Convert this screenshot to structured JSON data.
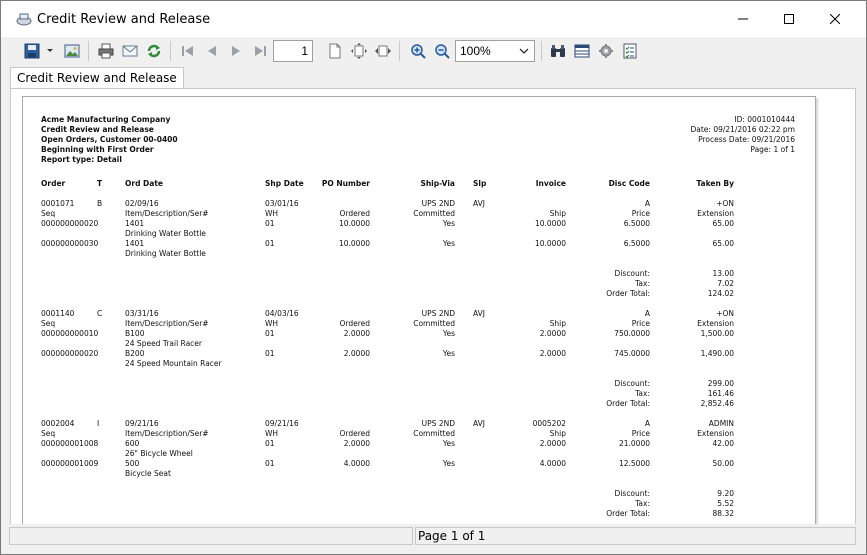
{
  "window": {
    "title": "Credit Review and Release"
  },
  "toolbar": {
    "page_number": "1",
    "zoom": "100%"
  },
  "tab": {
    "label": "Credit Review and Release"
  },
  "report": {
    "header_left": [
      "Acme Manufacturing Company",
      "Credit Review and Release",
      "Open Orders, Customer 00-0400",
      "Beginning with First Order",
      "Report type: Detail"
    ],
    "header_right": [
      "ID: 0001010444",
      "Date: 09/21/2016 02:22 pm",
      "Process Date: 09/21/2016",
      "Page: 1 of 1"
    ],
    "columns": {
      "order": "Order",
      "t": "T",
      "ord_date": "Ord Date",
      "shp_date": "Shp Date",
      "po": "PO Number",
      "ship_via": "Ship-Via",
      "slp": "Slp",
      "invoice": "Invoice",
      "disc": "Disc Code",
      "taken_by": "Taken By"
    },
    "sub_labels": {
      "seq": "Seq",
      "item": "Item/Description/Ser#",
      "wh": "WH",
      "ordered": "Ordered",
      "committed": "Committed",
      "ship": "Ship",
      "price": "Price",
      "extension": "Extension",
      "discount": "Discount:",
      "tax": "Tax:",
      "order_total": "Order Total:"
    },
    "orders": [
      {
        "order": "0001071",
        "t": "B",
        "ord_date": "02/09/16",
        "shp_date": "03/01/16",
        "po": "",
        "ship_via": "UPS 2ND",
        "slp": "AVJ",
        "invoice": "",
        "disc": "A",
        "taken_by": "+ON",
        "lines": [
          {
            "seq": "000000000020",
            "item": "1401",
            "desc": "Drinking Water Bottle",
            "wh": "01",
            "ordered": "10.0000",
            "committed": "Yes",
            "ship": "10.0000",
            "price": "6.5000",
            "ext": "65.00"
          },
          {
            "seq": "000000000030",
            "item": "1401",
            "desc": "Drinking Water Bottle",
            "wh": "01",
            "ordered": "10.0000",
            "committed": "Yes",
            "ship": "10.0000",
            "price": "6.5000",
            "ext": "65.00"
          }
        ],
        "discount": "13.00",
        "tax": "7.02",
        "total": "124.02"
      },
      {
        "order": "0001140",
        "t": "C",
        "ord_date": "03/31/16",
        "shp_date": "04/03/16",
        "po": "",
        "ship_via": "UPS 2ND",
        "slp": "AVJ",
        "invoice": "",
        "disc": "A",
        "taken_by": "+ON",
        "lines": [
          {
            "seq": "000000000010",
            "item": "B100",
            "desc": "24 Speed Trail Racer",
            "wh": "01",
            "ordered": "2.0000",
            "committed": "Yes",
            "ship": "2.0000",
            "price": "750.0000",
            "ext": "1,500.00"
          },
          {
            "seq": "000000000020",
            "item": "B200",
            "desc": "24 Speed Mountain Racer",
            "wh": "01",
            "ordered": "2.0000",
            "committed": "Yes",
            "ship": "2.0000",
            "price": "745.0000",
            "ext": "1,490.00"
          }
        ],
        "discount": "299.00",
        "tax": "161.46",
        "total": "2,852.46"
      },
      {
        "order": "0002004",
        "t": "I",
        "ord_date": "09/21/16",
        "shp_date": "09/21/16",
        "po": "",
        "ship_via": "UPS 2ND",
        "slp": "AVJ",
        "invoice": "0005202",
        "disc": "A",
        "taken_by": "ADMIN",
        "lines": [
          {
            "seq": "000000001008",
            "item": "600",
            "desc": "26\" Bicycle Wheel",
            "wh": "01",
            "ordered": "2.0000",
            "committed": "Yes",
            "ship": "2.0000",
            "price": "21.0000",
            "ext": "42.00"
          },
          {
            "seq": "000000001009",
            "item": "500",
            "desc": "Bicycle Seat",
            "wh": "01",
            "ordered": "4.0000",
            "committed": "Yes",
            "ship": "4.0000",
            "price": "12.5000",
            "ext": "50.00"
          }
        ],
        "discount": "9.20",
        "tax": "5.52",
        "total": "88.32"
      }
    ]
  },
  "status": {
    "page_info": "Page 1 of 1"
  }
}
